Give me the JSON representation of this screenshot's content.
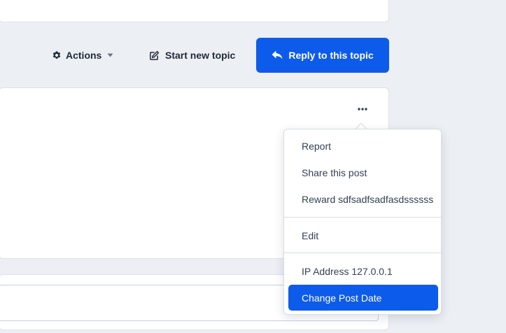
{
  "toolbar": {
    "actions_label": "Actions",
    "new_topic_label": "Start new topic",
    "reply_label": "Reply to this topic"
  },
  "post_menu": {
    "items": [
      {
        "label": "Report"
      },
      {
        "label": "Share this post"
      },
      {
        "label": "Reward sdfsadfsadfasdssssss"
      },
      {
        "label": "Edit"
      },
      {
        "label": "IP Address 127.0.0.1"
      },
      {
        "label": "Change Post Date"
      }
    ]
  },
  "colors": {
    "accent": "#0d5bea",
    "background": "#eceff4",
    "text": "#334155"
  },
  "icons": {
    "actions": "gear-icon",
    "actions_caret": "caret-down-icon",
    "new_topic": "edit-icon",
    "reply": "reply-arrow-icon",
    "more": "ellipsis-icon"
  }
}
